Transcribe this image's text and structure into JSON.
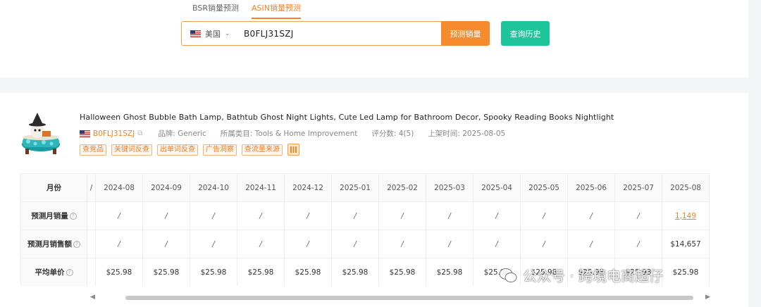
{
  "tabs": [
    {
      "label": "BSR销量预测",
      "active": false
    },
    {
      "label": "ASIN销量预测",
      "active": true
    }
  ],
  "search": {
    "country": "美国",
    "asin_value": "B0FLJ31SZJ",
    "predict_button": "预测销量",
    "history_button": "查询历史"
  },
  "product": {
    "title": "Halloween Ghost Bubble Bath Lamp, Bathtub Ghost Night Lights, Cute Led Lamp for Bathroom Decor, Spooky Reading Books Nightlight",
    "asin": "B0FLJ31SZJ",
    "brand": "品牌: Generic",
    "category": "所属类目: Tools & Home Improvement",
    "rating": "评分数: 4(5)",
    "listed": "上架时间: 2025-08-05",
    "tags": [
      "查竞品",
      "关键词反查",
      "出单词反查",
      "广告洞察",
      "查流量来源"
    ]
  },
  "table": {
    "header_label": "月份",
    "truncated_col": "/",
    "months": [
      "2024-08",
      "2024-09",
      "2024-10",
      "2024-11",
      "2024-12",
      "2025-01",
      "2025-02",
      "2025-03",
      "2025-04",
      "2025-05",
      "2025-06",
      "2025-07",
      "2025-08"
    ],
    "rows": [
      {
        "label": "预测月销量",
        "values": [
          "/",
          "/",
          "/",
          "/",
          "/",
          "/",
          "/",
          "/",
          "/",
          "/",
          "/",
          "/",
          "1,149"
        ]
      },
      {
        "label": "预测月销售额",
        "values": [
          "/",
          "/",
          "/",
          "/",
          "/",
          "/",
          "/",
          "/",
          "/",
          "/",
          "/",
          "/",
          "$14,657"
        ]
      },
      {
        "label": "平均单价",
        "values": [
          "$25.98",
          "$25.98",
          "$25.98",
          "$25.98",
          "$25.98",
          "$25.98",
          "$25.98",
          "$25.98",
          "$25.98",
          "$25.98",
          "$25.98",
          "$25.98",
          "$25.98"
        ]
      }
    ]
  },
  "watermark": "公众号 · 跨境电商超仔",
  "colors": {
    "accent": "#f5822a",
    "green": "#1fc59a"
  }
}
